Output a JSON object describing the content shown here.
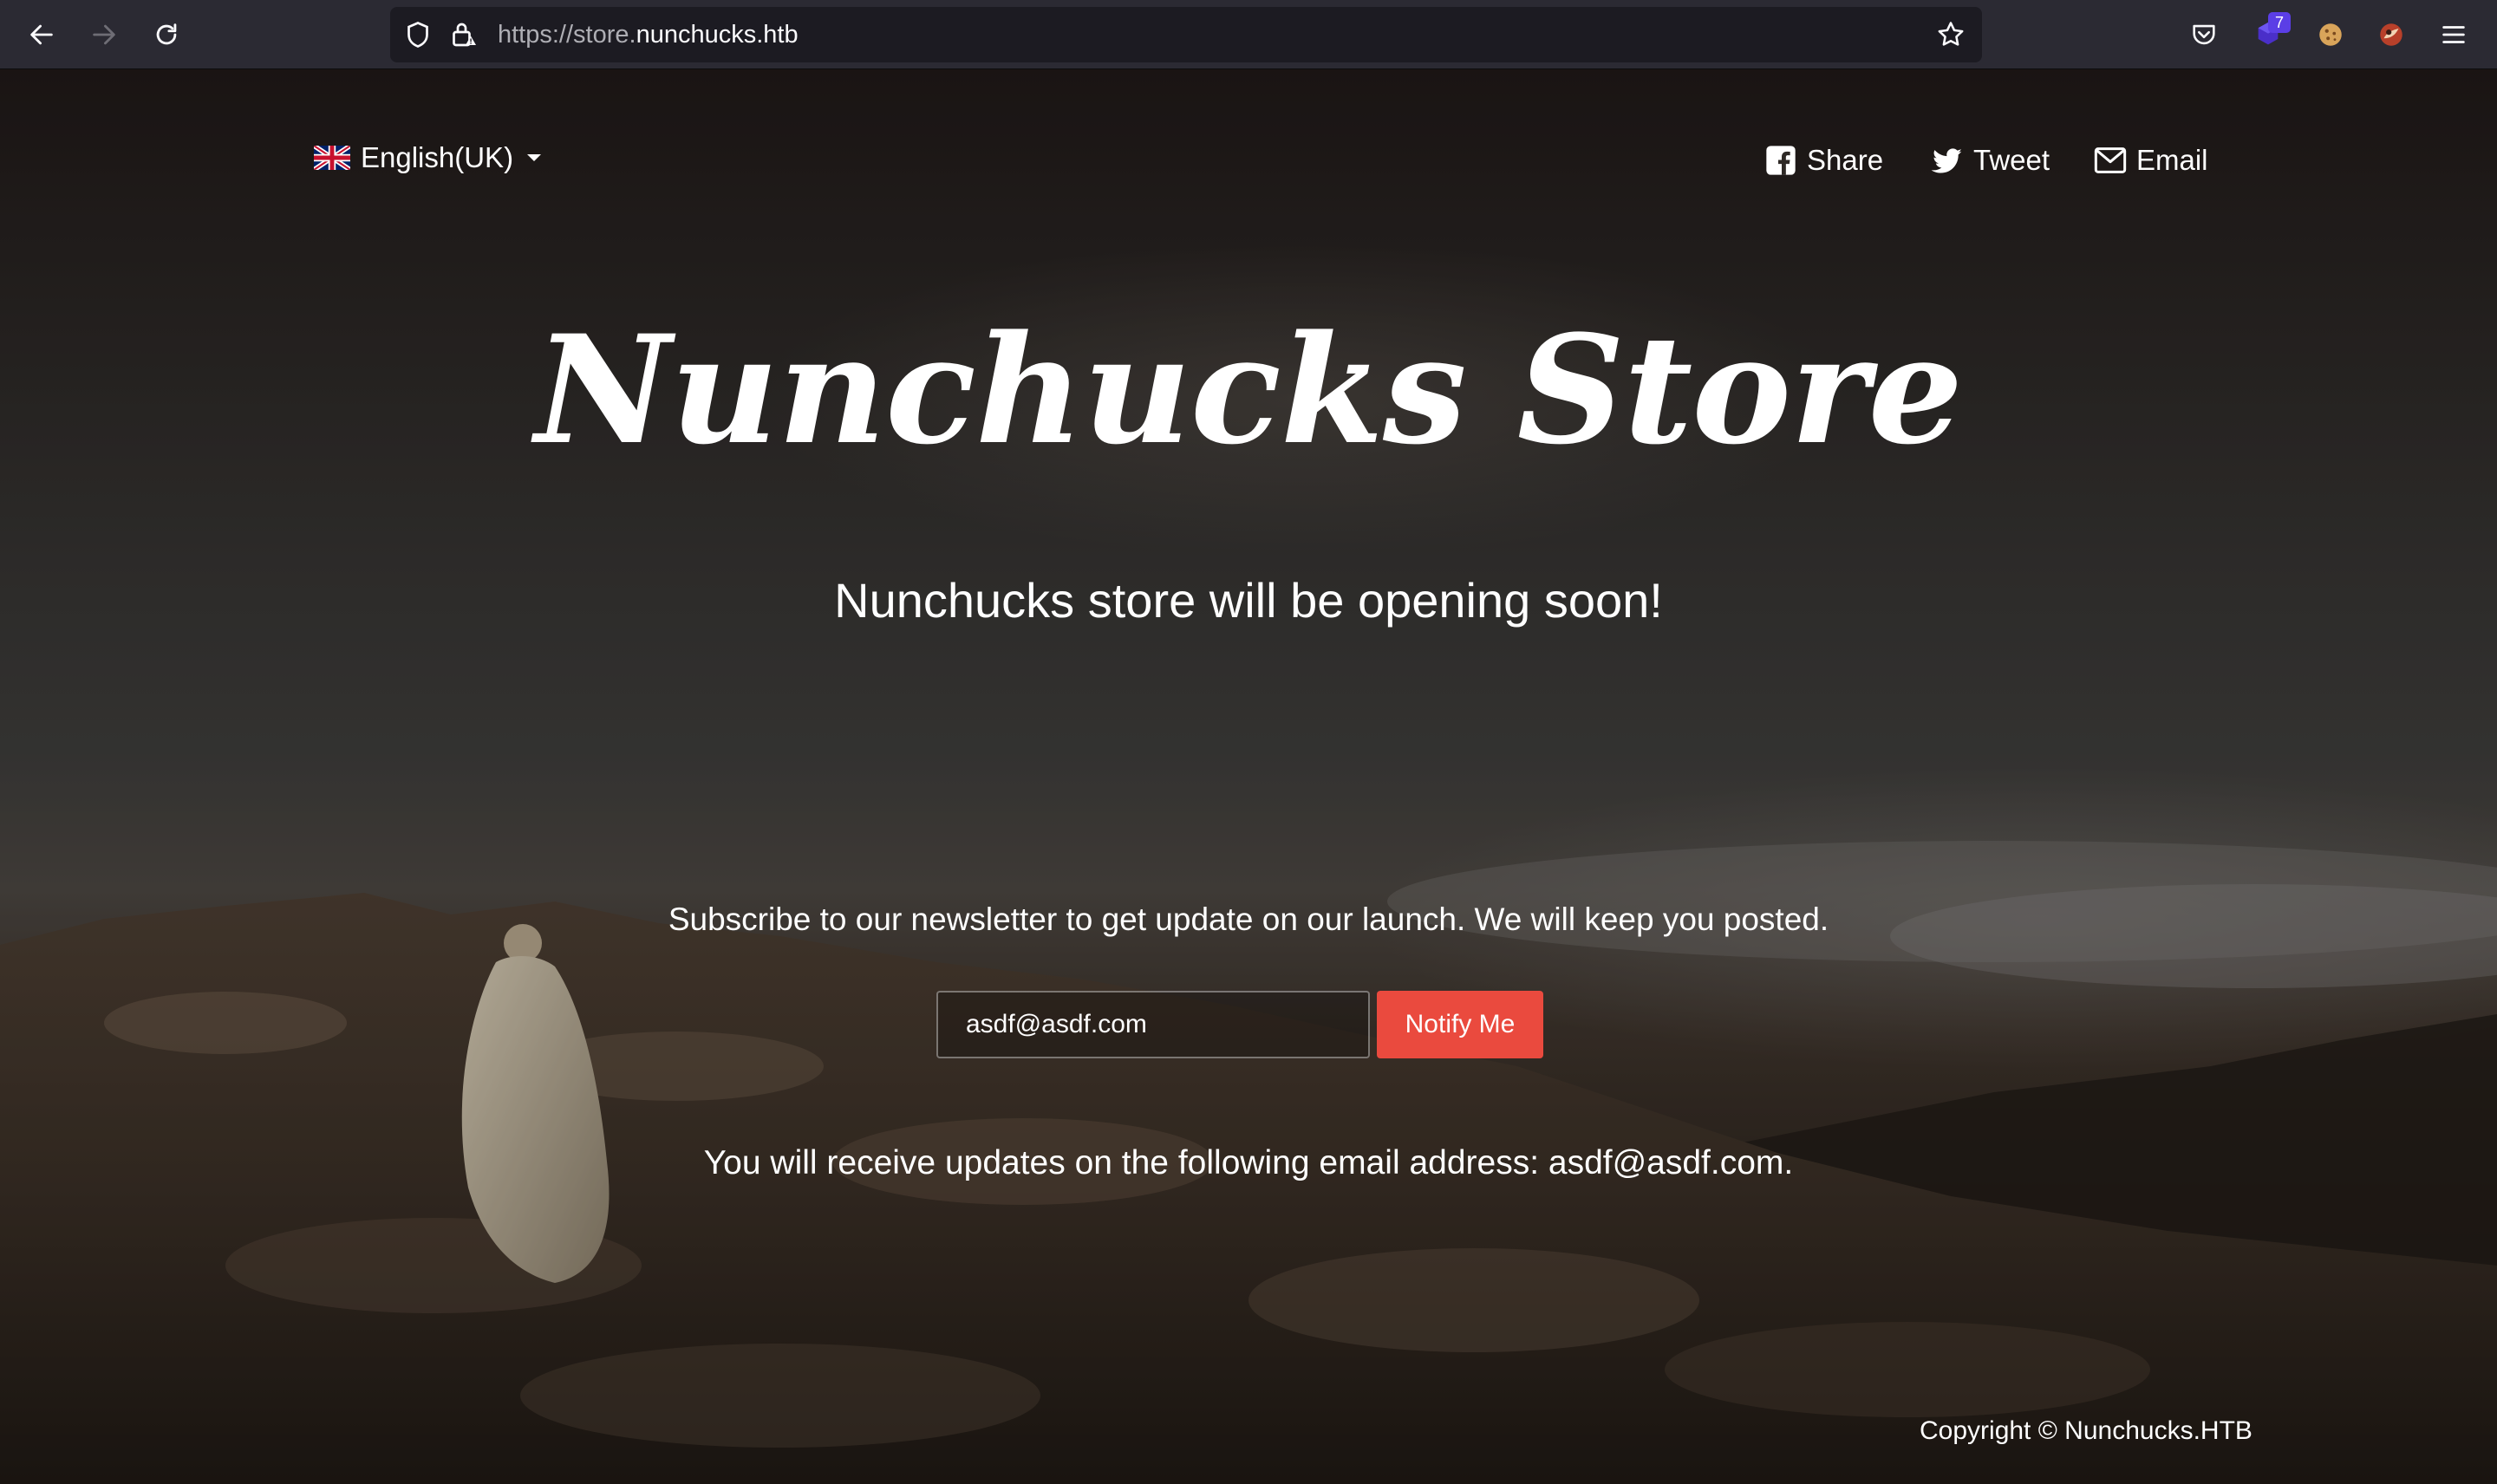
{
  "browser": {
    "url_prefix": "https://store.",
    "url_domain": "nunchucks.htb",
    "extension_badge": "7"
  },
  "header": {
    "language": "English(UK)",
    "share_label": "Share",
    "tweet_label": "Tweet",
    "email_label": "Email"
  },
  "hero": {
    "title": "Nunchucks Store",
    "subtitle": "Nunchucks store will be opening soon!"
  },
  "newsletter": {
    "text": "Subscribe to our newsletter to get update on our launch. We will keep you posted.",
    "email_value": "asdf@asdf.com",
    "button_label": "Notify Me",
    "confirmation": "You will receive updates on the following email address: asdf@asdf.com."
  },
  "footer": {
    "copyright": "Copyright © Nunchucks.HTB"
  },
  "colors": {
    "chrome_bg": "#2b2a33",
    "urlbar_bg": "#1c1b22",
    "button_red": "#ea4a3e"
  }
}
